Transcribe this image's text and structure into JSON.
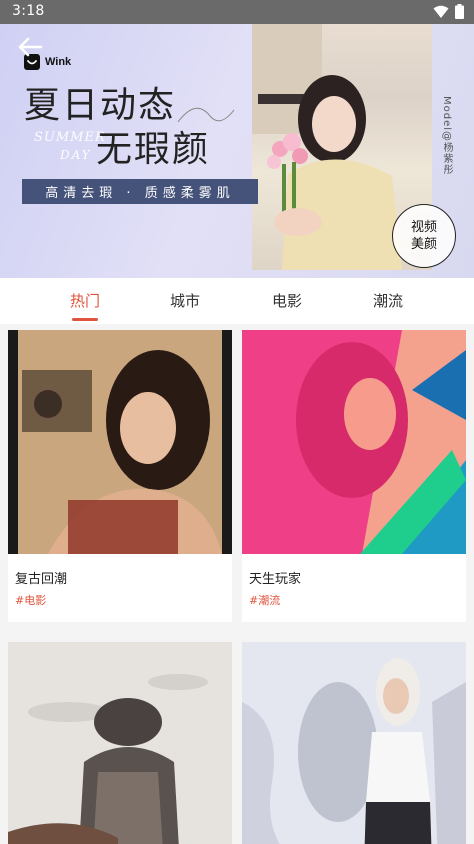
{
  "status_bar": {
    "time": "3:18"
  },
  "banner": {
    "logo": "Wink",
    "headline_1": "夏日动态",
    "headline_2": "无瑕颜",
    "deco_1": "SUMMER",
    "deco_2": "DAY",
    "tagline": "高清去瑕 · 质感柔雾肌",
    "watermark": "Model@杨紫彤",
    "badge_line_1": "视频",
    "badge_line_2": "美颜",
    "dots_total": 2,
    "dots_active_index": 0
  },
  "tabs": [
    {
      "label": "热门",
      "active": true
    },
    {
      "label": "城市",
      "active": false
    },
    {
      "label": "电影",
      "active": false
    },
    {
      "label": "潮流",
      "active": false
    }
  ],
  "cards": [
    {
      "title": "复古回潮",
      "tag": "#电影"
    },
    {
      "title": "天生玩家",
      "tag": "#潮流"
    },
    {
      "title": "",
      "tag": ""
    },
    {
      "title": "",
      "tag": ""
    }
  ],
  "colors": {
    "accent": "#e0533c",
    "banner_bg": "#d6d6f2",
    "tagline_bg": "#45527a"
  }
}
